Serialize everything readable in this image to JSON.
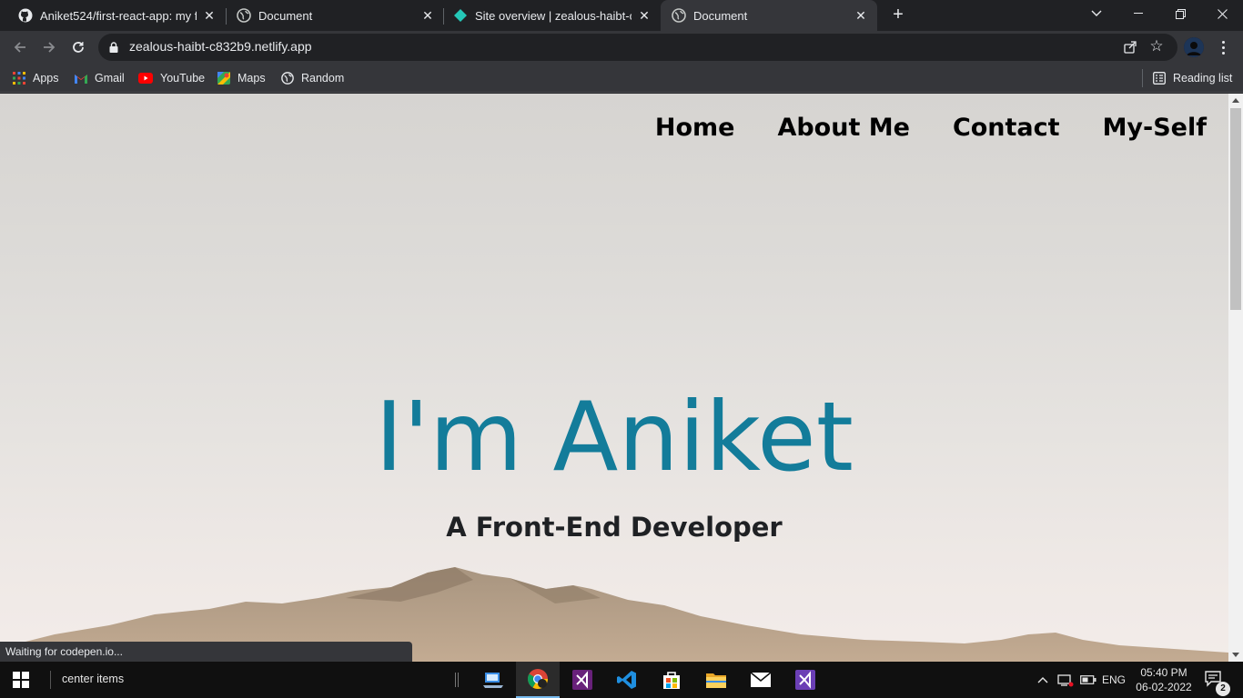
{
  "browser": {
    "tabs": [
      {
        "title": "Aniket524/first-react-app: my first",
        "icon": "github-icon",
        "active": false
      },
      {
        "title": "Document",
        "icon": "globe-icon",
        "active": false
      },
      {
        "title": "Site overview | zealous-haibt-c832",
        "icon": "netlify-icon",
        "active": false
      },
      {
        "title": "Document",
        "icon": "globe-icon",
        "active": true
      }
    ],
    "url": "zealous-haibt-c832b9.netlify.app",
    "bookmarks": [
      {
        "label": "Apps",
        "icon": "apps-grid-icon"
      },
      {
        "label": "Gmail",
        "icon": "gmail-icon"
      },
      {
        "label": "YouTube",
        "icon": "youtube-icon"
      },
      {
        "label": "Maps",
        "icon": "maps-icon"
      },
      {
        "label": "Random",
        "icon": "globe-icon"
      }
    ],
    "reading_list": "Reading list",
    "status": "Waiting for codepen.io..."
  },
  "page": {
    "nav": [
      "Home",
      "About Me",
      "Contact",
      "My-Self"
    ],
    "hero_title": "I'm Aniket",
    "hero_subtitle": "A Front-End Developer",
    "colors": {
      "title": "#137c9a",
      "nav": "#000000",
      "subtitle": "#1f2124"
    }
  },
  "taskbar": {
    "search_text": "center items",
    "apps": [
      "file-explorer-laptop-icon",
      "chrome-icon",
      "visual-studio-icon",
      "vscode-icon",
      "store-icon",
      "folder-icon",
      "mail-icon",
      "visual-studio-preview-icon"
    ],
    "language": "ENG",
    "time": "05:40 PM",
    "date": "06-02-2022",
    "notification_count": "2"
  }
}
